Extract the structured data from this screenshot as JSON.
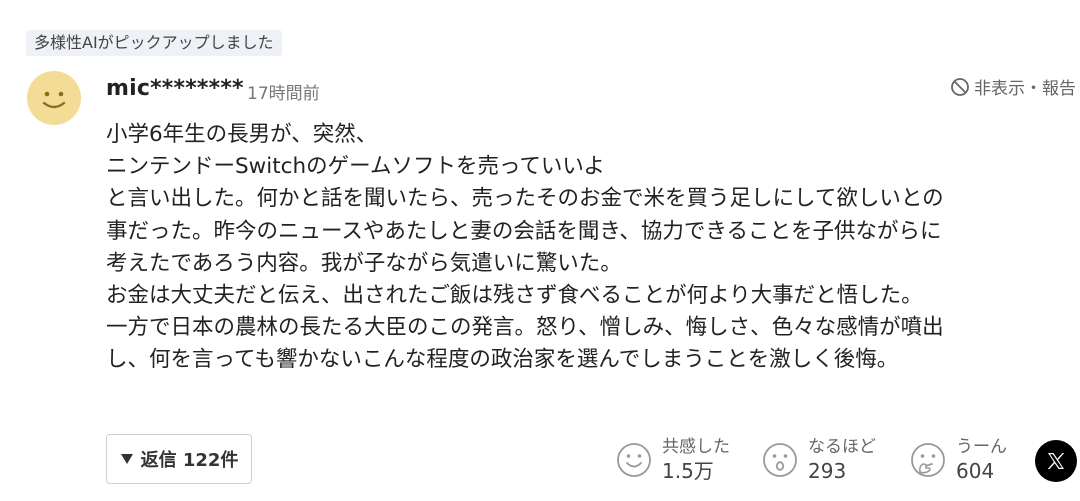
{
  "badge": "多様性AIがピックアップしました",
  "comment": {
    "username": "mic********",
    "time": "17時間前",
    "hide_report": "非表示・報告",
    "lines": [
      "小学6年生の長男が、突然、",
      "ニンテンドーSwitchのゲームソフトを売っていいよ",
      "と言い出した。何かと話を聞いたら、売ったそのお金で米を買う足しにして欲しいとの",
      "事だった。昨今のニュースやあたしと妻の会話を聞き、協力できることを子供ながらに",
      "考えたであろう内容。我が子ながら気遣いに驚いた。",
      "お金は大丈夫だと伝え、出されたご飯は残さず食べることが何より大事だと悟した。",
      "一方で日本の農林の長たる大臣のこの発言。怒り、憎しみ、悔しさ、色々な感情が噴出",
      "し、何を言っても響かないこんな程度の政治家を選んでしまうことを激しく後悔。"
    ]
  },
  "reply": {
    "label": "返信 122件"
  },
  "reactions": [
    {
      "label": "共感した",
      "count": "1.5万",
      "icon": "smile-icon"
    },
    {
      "label": "なるほど",
      "count": "293",
      "icon": "surprised-icon"
    },
    {
      "label": "うーん",
      "count": "604",
      "icon": "thinking-icon"
    }
  ],
  "share": {
    "icon": "x-logo-icon"
  }
}
